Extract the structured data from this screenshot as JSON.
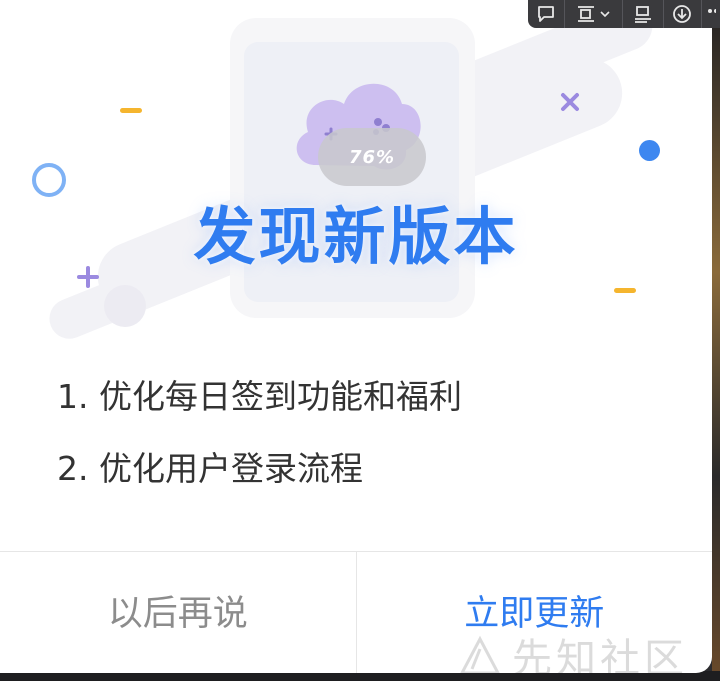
{
  "dialog": {
    "title": "发现新版本",
    "progress_badge": "76%",
    "notes": [
      "1. 优化每日签到功能和福利",
      "2. 优化用户登录流程"
    ],
    "buttons": {
      "later": "以后再说",
      "update": "立即更新"
    },
    "colors": {
      "accent": "#2f7cf0",
      "muted": "#8c8c8c",
      "text": "#333333"
    }
  },
  "watermark": {
    "text": "先知社区"
  },
  "toolbar": {
    "icons": [
      "comment-icon",
      "layout-icon",
      "chevron-down-icon",
      "align-icon",
      "download-icon",
      "more-icon"
    ]
  }
}
